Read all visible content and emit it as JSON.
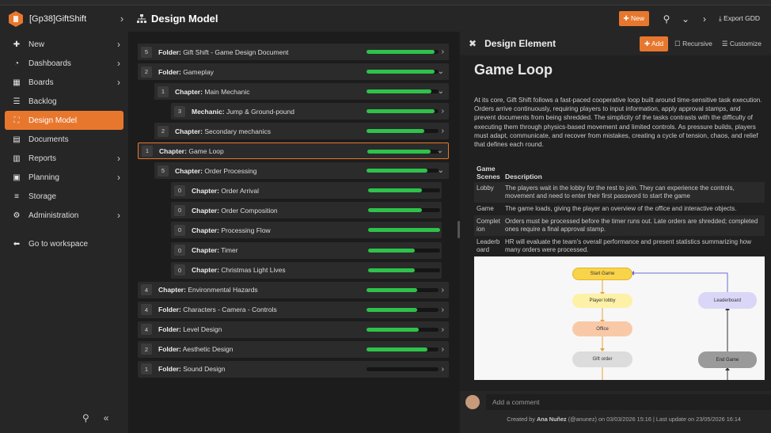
{
  "brand": {
    "name": "[Gp38]GiftShift",
    "logo_icon": "hexagon-logo"
  },
  "sidebar": {
    "items": [
      {
        "label": "New",
        "icon": "plus-icon",
        "arrow": true
      },
      {
        "label": "Dashboards",
        "icon": "dashboard-icon",
        "arrow": true
      },
      {
        "label": "Boards",
        "icon": "board-icon",
        "arrow": true
      },
      {
        "label": "Backlog",
        "icon": "list-icon",
        "arrow": false
      },
      {
        "label": "Design Model",
        "icon": "sitemap-icon",
        "arrow": false,
        "active": true
      },
      {
        "label": "Documents",
        "icon": "book-icon",
        "arrow": false
      },
      {
        "label": "Reports",
        "icon": "chart-icon",
        "arrow": true
      },
      {
        "label": "Planning",
        "icon": "calendar-icon",
        "arrow": true
      },
      {
        "label": "Storage",
        "icon": "database-icon",
        "arrow": false
      },
      {
        "label": "Administration",
        "icon": "gear-icon",
        "arrow": true
      }
    ],
    "workspace": "Go to workspace"
  },
  "header": {
    "title": "Design Model",
    "new_label": "New",
    "export_label": "Export GDD"
  },
  "tree": {
    "rows": [
      {
        "count": "5",
        "kind": "Folder:",
        "name": "Gift Shift - Game Design Document",
        "progress": 0.95,
        "arrow": "right"
      },
      {
        "count": "2",
        "kind": "Folder:",
        "name": "Gameplay",
        "progress": 0.95,
        "arrow": "down"
      },
      {
        "count": "1",
        "kind": "Chapter:",
        "name": "Main Mechanic",
        "progress": 0.9,
        "arrow": "down"
      },
      {
        "count": "3",
        "kind": "Mechanic:",
        "name": "Jump & Ground-pound",
        "progress": 0.95,
        "arrow": "right"
      },
      {
        "count": "2",
        "kind": "Chapter:",
        "name": "Secondary mechanics",
        "progress": 0.8,
        "arrow": "right"
      },
      {
        "count": "1",
        "kind": "Chapter:",
        "name": "Game Loop",
        "progress": 0.88,
        "arrow": "down",
        "highlight": true
      },
      {
        "count": "5",
        "kind": "Chapter:",
        "name": "Order Processing",
        "progress": 0.85,
        "arrow": "down"
      },
      {
        "count": "0",
        "kind": "Chapter:",
        "name": "Order Arrival",
        "progress": 0.75,
        "arrow": ""
      },
      {
        "count": "0",
        "kind": "Chapter:",
        "name": "Order Composition",
        "progress": 0.75,
        "arrow": ""
      },
      {
        "count": "0",
        "kind": "Chapter:",
        "name": "Processing Flow",
        "progress": 1.0,
        "arrow": ""
      },
      {
        "count": "0",
        "kind": "Chapter:",
        "name": "Timer",
        "progress": 0.65,
        "arrow": ""
      },
      {
        "count": "0",
        "kind": "Chapter:",
        "name": "Christmas Light Lives",
        "progress": 0.65,
        "arrow": ""
      },
      {
        "count": "4",
        "kind": "Chapter:",
        "name": "Environmental Hazards",
        "progress": 0.7,
        "arrow": "right"
      },
      {
        "count": "4",
        "kind": "Folder:",
        "name": "Characters - Camera - Controls",
        "progress": 0.7,
        "arrow": "right"
      },
      {
        "count": "4",
        "kind": "Folder:",
        "name": "Level Design",
        "progress": 0.72,
        "arrow": "right"
      },
      {
        "count": "2",
        "kind": "Folder:",
        "name": "Aesthetic Design",
        "progress": 0.85,
        "arrow": "right"
      },
      {
        "count": "1",
        "kind": "Folder:",
        "name": "Sound Design",
        "progress": 0.0,
        "arrow": "right"
      }
    ]
  },
  "detail": {
    "panel_title": "Design Element",
    "add_label": "Add",
    "recursive_label": "Recursive",
    "customize_label": "Customize",
    "heading": "Game Loop",
    "paragraph": "At its core, Gift Shift follows a fast-paced cooperative loop built around time-sensitive task execution. Orders arrive continuously, requiring players to input information, apply approval stamps, and prevent documents from being shredded. The simplicity of the tasks contrasts with the difficulty of executing them through physics-based movement and limited controls. As pressure builds, players must adapt, communicate, and recover from mistakes, creating a cycle of tension, chaos, and relief that defines each round.",
    "table": {
      "col1": "Game Scenes",
      "col2": "Description",
      "rows": [
        {
          "scene": "Lobby",
          "desc": "The players wait in the lobby for the rest to join. They can experience the controls, movement and need to enter their first password to start the game"
        },
        {
          "scene": "Game",
          "desc": "The game loads, giving the player an overview of the office and interactive objects."
        },
        {
          "scene": "Completion",
          "desc": "Orders must be processed before the timer runs out. Late orders are shredded; completed ones require a final approval stamp."
        },
        {
          "scene": "Leaderboard",
          "desc": "HR will evaluate the team's overall performance and present statistics summarizing how many orders were processed."
        }
      ]
    },
    "diagram": {
      "nodes": [
        "Start Game",
        "Player lobby",
        "Office",
        "Gift order",
        "Leaderboard",
        "End Game"
      ]
    },
    "comment_placeholder": "Add a comment",
    "footer_created": "Created by",
    "footer_author": "Ana Nuñez",
    "footer_rest": "(@anunez) on 03/03/2026 15:16 | Last update on 23/05/2026 16:14"
  }
}
